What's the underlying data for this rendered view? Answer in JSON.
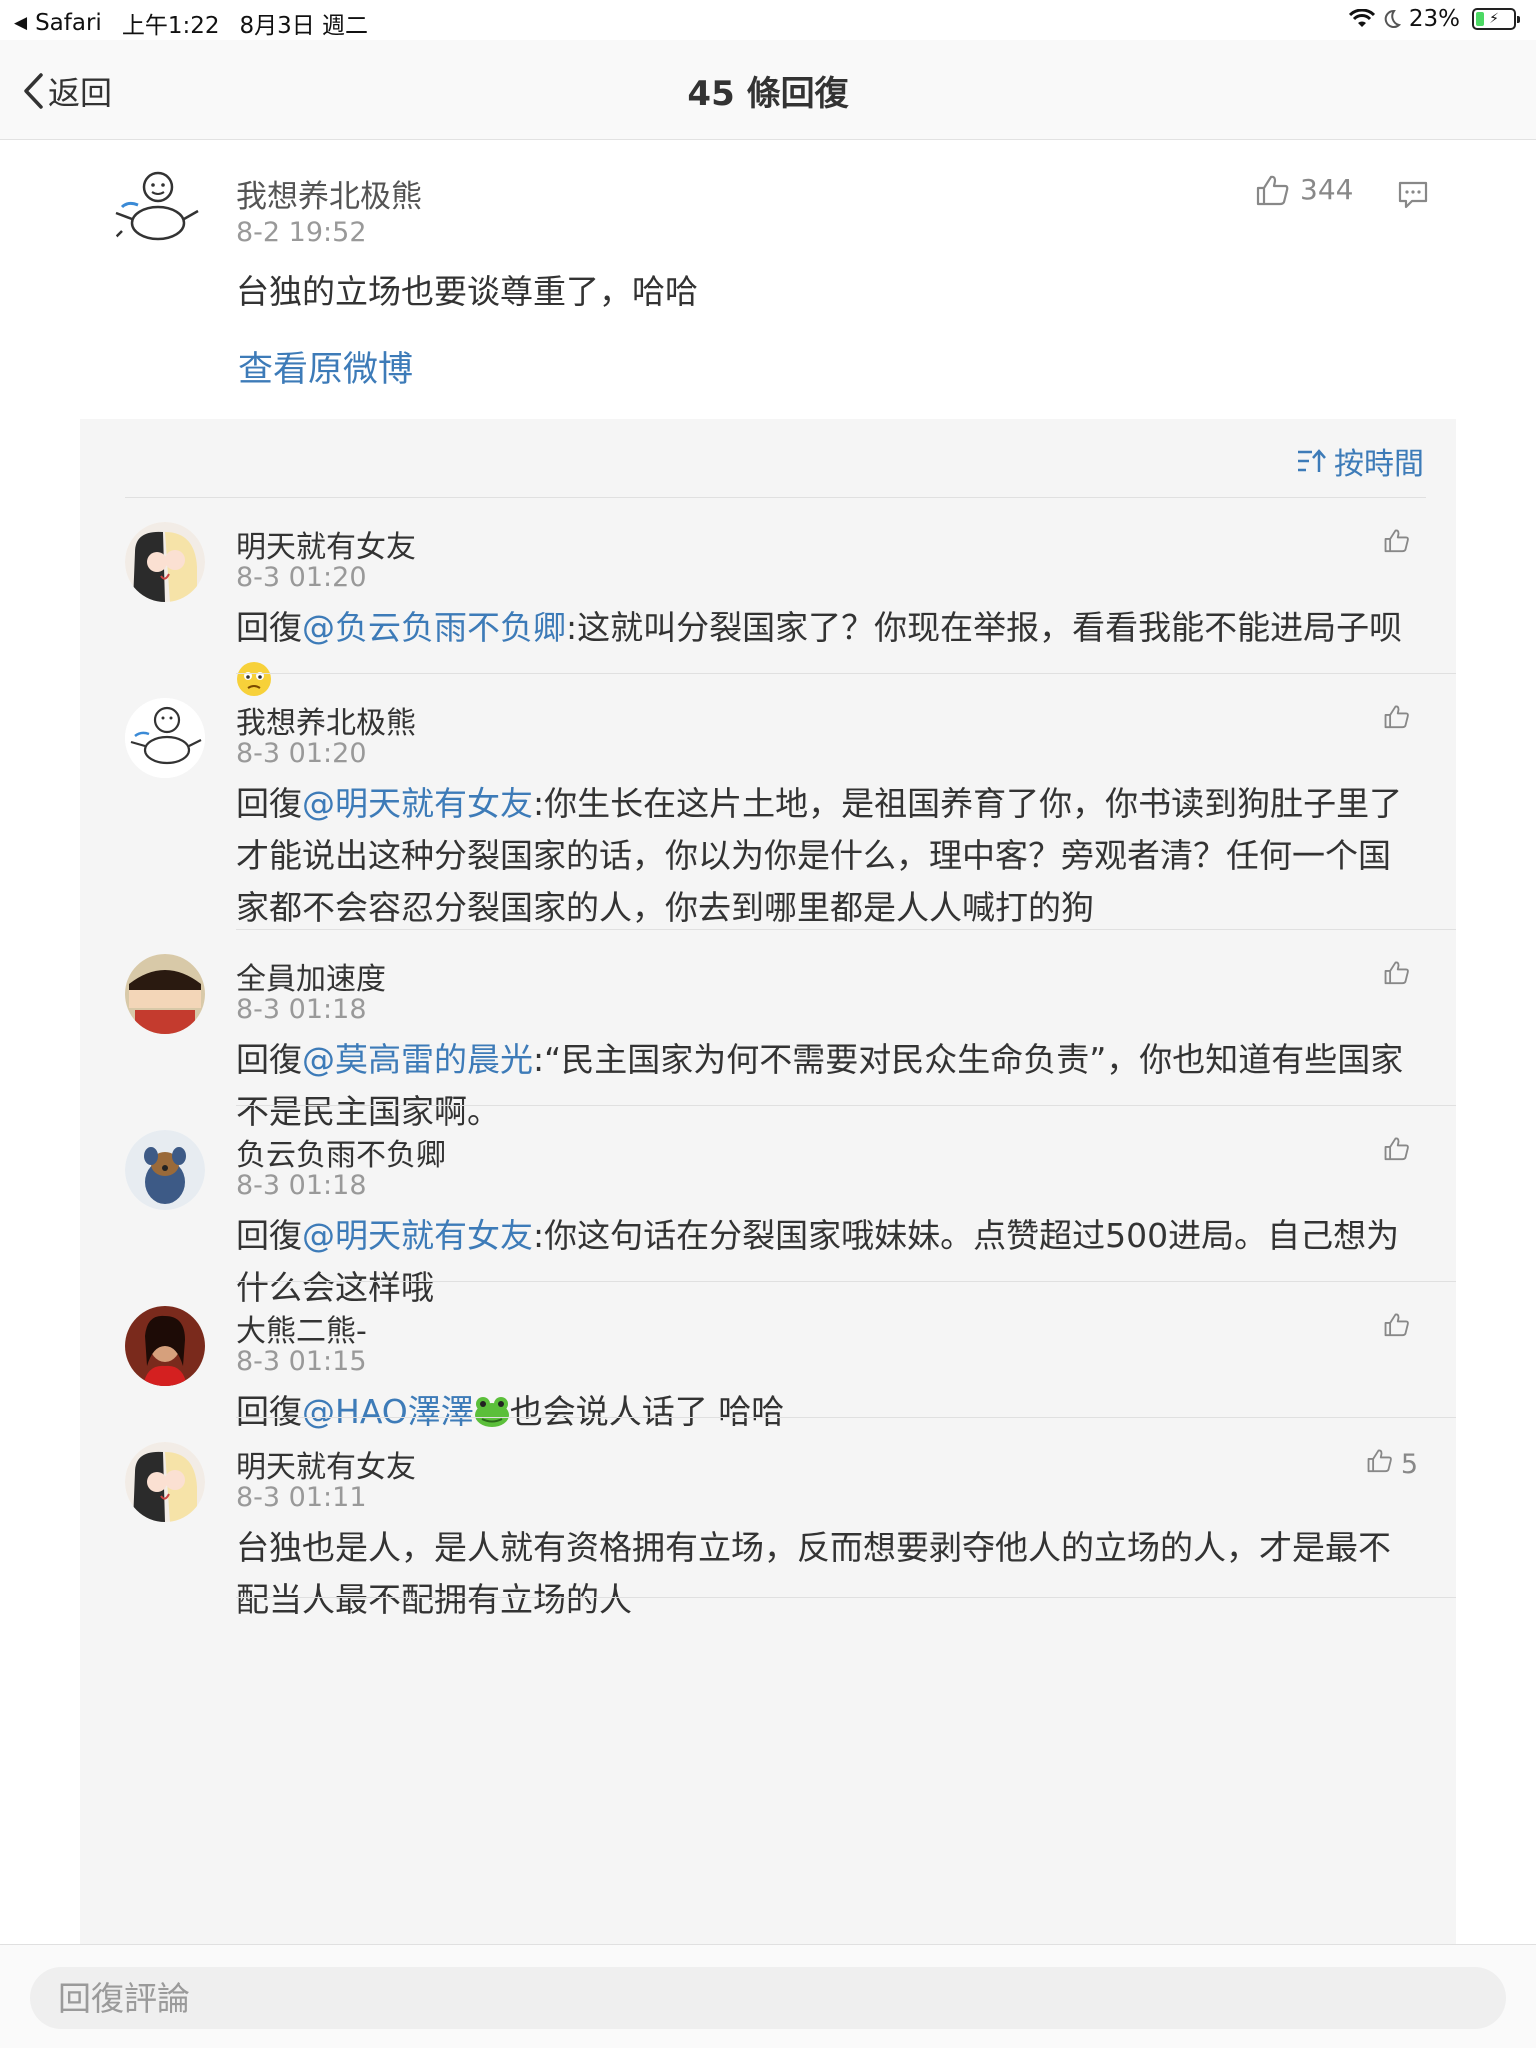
{
  "status_bar": {
    "app": "Safari",
    "time": "上午1:22",
    "date": "8月3日 週二",
    "battery": "23%",
    "battery_level": 0.23
  },
  "nav": {
    "back_label": "返回",
    "title": "45 條回復"
  },
  "main_comment": {
    "user": "我想养北极熊",
    "time": "8-2 19:52",
    "likes": "344",
    "text": "台独的立场也要谈尊重了，哈哈",
    "view_original": "查看原微博"
  },
  "sort_label": "按時間",
  "replies": [
    {
      "user": "明天就有女友",
      "time": "8-3 01:20",
      "likes": "",
      "prefix": "回復",
      "mention": "@负云负雨不负卿",
      "text": ":这就叫分裂国家了？你现在举报，看看我能不能进局子呗",
      "emoji": "confused-emoji"
    },
    {
      "user": "我想养北极熊",
      "time": "8-3 01:20",
      "likes": "",
      "prefix": "回復",
      "mention": "@明天就有女友",
      "text": ":你生长在这片土地，是祖国养育了你，你书读到狗肚子里了才能说出这种分裂国家的话，你以为你是什么，理中客？旁观者清？任何一个国家都不会容忍分裂国家的人，你去到哪里都是人人喊打的狗"
    },
    {
      "user": "全員加速度",
      "time": "8-3 01:18",
      "likes": "",
      "prefix": "回復",
      "mention": "@莫高雷的晨光",
      "text": ":“民主国家为何不需要对民众生命负责”，你也知道有些国家不是民主国家啊。"
    },
    {
      "user": "负云负雨不负卿",
      "time": "8-3 01:18",
      "likes": "",
      "prefix": "回復",
      "mention": "@明天就有女友",
      "text": ":你这句话在分裂国家哦妹妹。点赞超过500进局。自己想为什么会这样哦"
    },
    {
      "user": "大熊二熊-",
      "time": "8-3 01:15",
      "likes": "",
      "prefix": "回復",
      "mention": "@HAO澤澤",
      "text": "也会说人话了 哈哈",
      "emoji": "frog-emoji"
    },
    {
      "user": "明天就有女友",
      "time": "8-3 01:11",
      "likes": "5",
      "prefix": "",
      "mention": "",
      "text": "台独也是人，是人就有资格拥有立场，反而想要剥夺他人的立场的人，才是最不配当人最不配拥有立场的人"
    }
  ],
  "input": {
    "placeholder": "回復評論"
  },
  "colors": {
    "link": "#3d7bb8",
    "panel_bg": "#f5f5f5",
    "battery_green": "#4cd964"
  }
}
